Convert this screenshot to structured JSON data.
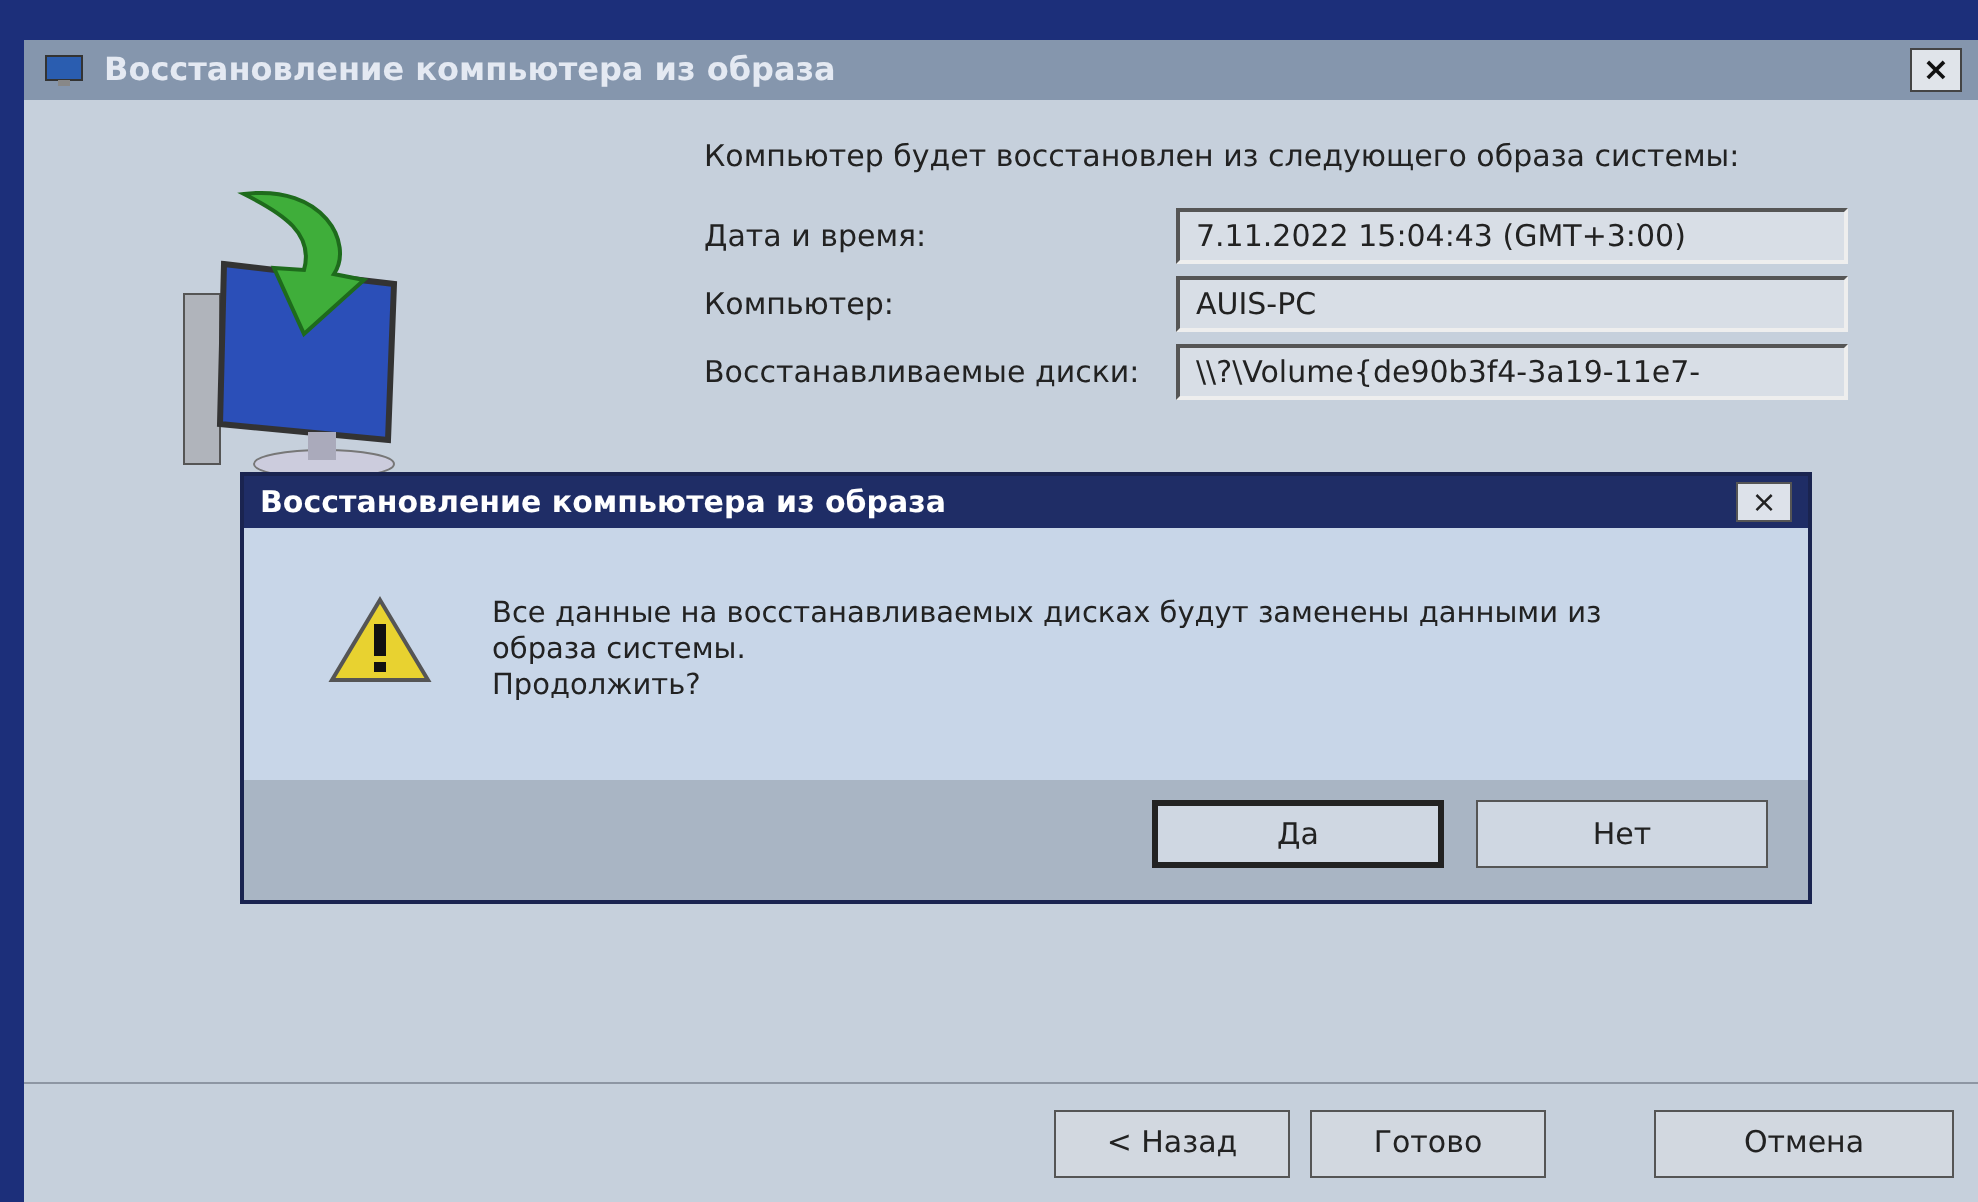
{
  "window": {
    "title": "Восстановление компьютера из образа",
    "close": "×"
  },
  "content": {
    "intro": "Компьютер будет восстановлен из следующего образа системы:",
    "fields": [
      {
        "label": "Дата и время:",
        "value": "7.11.2022 15:04:43 (GMT+3:00)"
      },
      {
        "label": "Компьютер:",
        "value": "AUIS-PC"
      },
      {
        "label": "Восстанавливаемые диски:",
        "value": "\\\\?\\Volume{de90b3f4-3a19-11e7-"
      }
    ]
  },
  "buttons": [
    "< Назад",
    "Готово",
    "Отмена"
  ],
  "dialog": {
    "title": "Восстановление компьютера из образа",
    "close": "×",
    "message": [
      "Все данные на восстанавливаемых дисках будут заменены данными из образа системы.",
      "Продолжить?"
    ],
    "buttons": [
      {
        "label": "Да",
        "focused": true
      },
      {
        "label": "Нет",
        "focused": false
      }
    ]
  }
}
